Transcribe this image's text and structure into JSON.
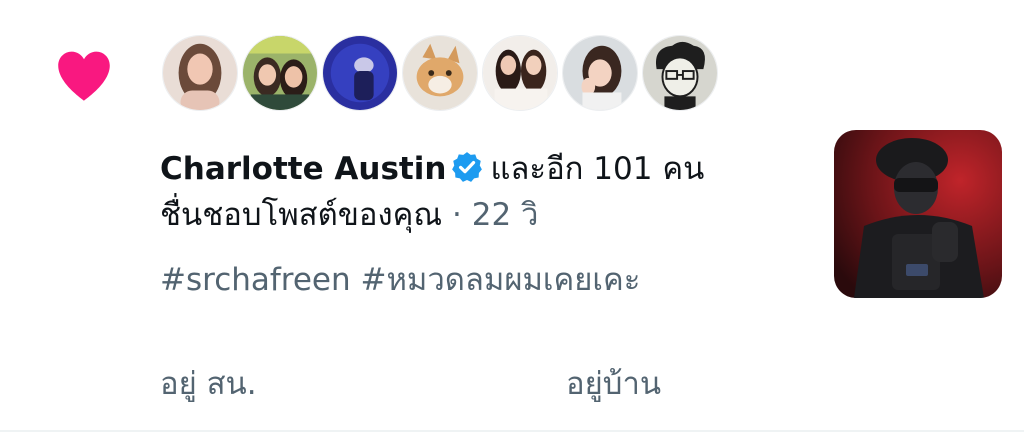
{
  "notification": {
    "type_icon": "heart-icon",
    "avatars": [
      {
        "icon": "avatar-woman-long-hair"
      },
      {
        "icon": "avatar-two-people"
      },
      {
        "icon": "avatar-concert-silhouette"
      },
      {
        "icon": "avatar-cat"
      },
      {
        "icon": "avatar-two-women"
      },
      {
        "icon": "avatar-woman-hand-on-cheek"
      },
      {
        "icon": "avatar-cartoon-face"
      }
    ],
    "user_name": "Charlotte Austin",
    "and_others": "และอีก 101 คน",
    "action": "ชื่นชอบโพสต์ของคุณ",
    "separator": " · ",
    "time": "22 วิ",
    "hashtags": "#srchafreen #หมวดลมผมเคยเคะ",
    "thumbnail_icon": "post-photo-thumbnail"
  },
  "tabs": {
    "left": "อยู่ สน.",
    "right": "อยู่บ้าน"
  },
  "colors": {
    "heart": "#f91880",
    "verified": "#1d9bf0",
    "secondary_text": "#536471"
  }
}
